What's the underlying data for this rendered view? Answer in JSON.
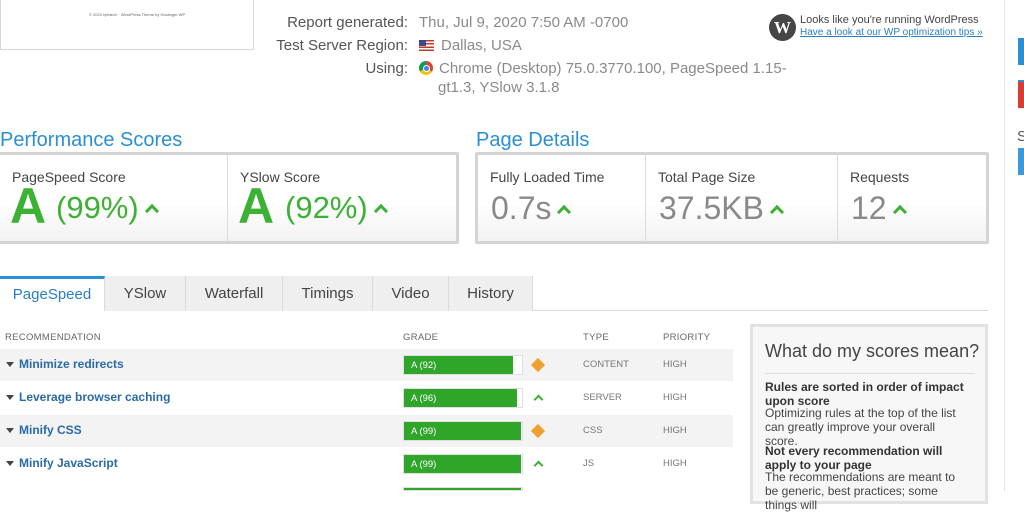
{
  "thumbnail": {
    "caption": "© 2020 hpbtech · WordPress Theme by Hostinger WP"
  },
  "report": {
    "generated_label": "Report generated:",
    "generated_value": "Thu, Jul 9, 2020 7:50 AM -0700",
    "region_label": "Test Server Region:",
    "region_value": "Dallas, USA",
    "using_label": "Using:",
    "using_line1": "Chrome (Desktop) 75.0.3770.100, PageSpeed 1.15-",
    "using_line2": "gt1.3, YSlow 3.1.8"
  },
  "wordpress": {
    "logo": "W",
    "title": "Looks like you're running WordPress",
    "link": "Have a look at our WP optimization tips »"
  },
  "side_buttons": {
    "colors": [
      "#2a8fd4",
      "#2a8fd4",
      "#d93b35",
      "#3a9ad9"
    ],
    "cut_label": "S"
  },
  "performance": {
    "title": "Performance Scores",
    "pagespeed_label": "PageSpeed Score",
    "pagespeed_grade": "A",
    "pagespeed_pct": "(99%)",
    "yslow_label": "YSlow Score",
    "yslow_grade": "A",
    "yslow_pct": "(92%)"
  },
  "details": {
    "title": "Page Details",
    "load_label": "Fully Loaded Time",
    "load_value": "0.7s",
    "size_label": "Total Page Size",
    "size_value": "37.5KB",
    "req_label": "Requests",
    "req_value": "12"
  },
  "tabs": [
    "PageSpeed",
    "YSlow",
    "Waterfall",
    "Timings",
    "Video",
    "History"
  ],
  "table": {
    "headers": {
      "rec": "RECOMMENDATION",
      "grade": "GRADE",
      "type": "TYPE",
      "priority": "PRIORITY"
    },
    "rows": [
      {
        "name": "Minimize redirects",
        "grade": "A (92)",
        "score": 0.92,
        "trend": "diamond",
        "type": "CONTENT",
        "priority": "HIGH"
      },
      {
        "name": "Leverage browser caching",
        "grade": "A (96)",
        "score": 0.96,
        "trend": "up",
        "type": "SERVER",
        "priority": "HIGH"
      },
      {
        "name": "Minify CSS",
        "grade": "A (99)",
        "score": 0.99,
        "trend": "diamond",
        "type": "CSS",
        "priority": "HIGH"
      },
      {
        "name": "Minify JavaScript",
        "grade": "A (99)",
        "score": 0.99,
        "trend": "up",
        "type": "JS",
        "priority": "HIGH"
      }
    ],
    "partial_row_score": 0.99
  },
  "help": {
    "title": "What do my scores mean?",
    "p1_bold": "Rules are sorted in order of impact upon score",
    "p1_text": "Optimizing rules at the top of the list can greatly improve your overall score.",
    "p2_bold": "Not every recommendation will apply to your page",
    "p2_text": "The recommendations are meant to be generic, best practices; some things will"
  }
}
